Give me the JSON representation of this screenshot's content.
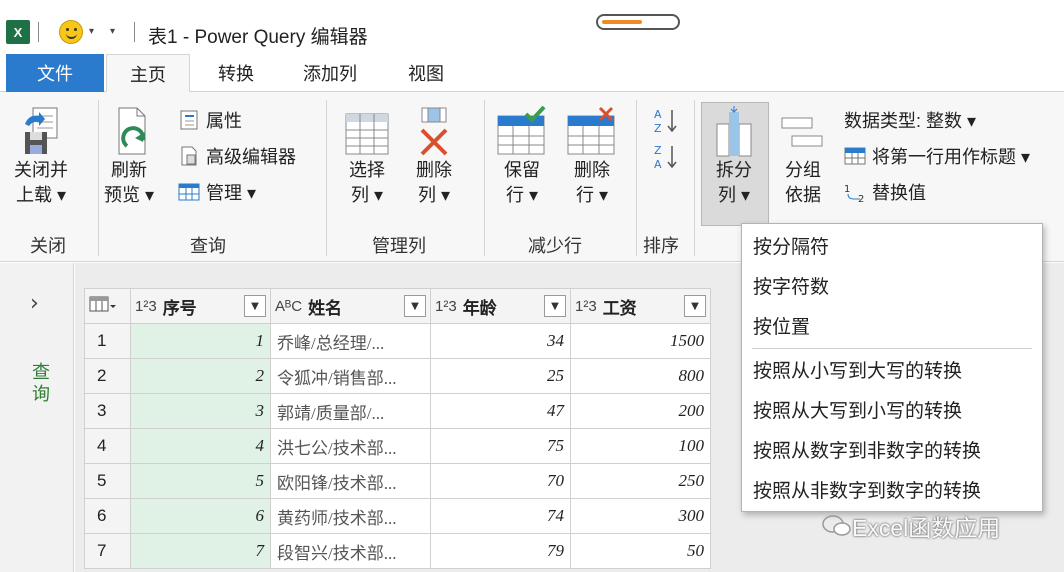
{
  "window": {
    "app_icon": "excel-icon",
    "title": "表1 - Power Query 编辑器",
    "progress_fraction": 0.55
  },
  "tabs": [
    {
      "label": "文件"
    },
    {
      "label": "主页",
      "active": true
    },
    {
      "label": "转换"
    },
    {
      "label": "添加列"
    },
    {
      "label": "视图"
    }
  ],
  "ribbon": {
    "close": {
      "btn_line1": "关闭并",
      "btn_line2": "上载 ▾",
      "group": "关闭"
    },
    "query": {
      "refresh_line1": "刷新",
      "refresh_line2": "预览 ▾",
      "properties": "属性",
      "advanced_editor": "高级编辑器",
      "manage": "管理 ▾",
      "group": "查询"
    },
    "manage_columns": {
      "choose_line1": "选择",
      "choose_line2": "列 ▾",
      "remove_line1": "删除",
      "remove_line2": "列 ▾",
      "group": "管理列"
    },
    "reduce_rows": {
      "keep_line1": "保留",
      "keep_line2": "行 ▾",
      "remove_line1": "删除",
      "remove_line2": "行 ▾",
      "group": "减少行"
    },
    "sort": {
      "group": "排序"
    },
    "transform": {
      "split_line1": "拆分",
      "split_line2": "列 ▾",
      "group_line1": "分组",
      "group_line2": "依据",
      "data_type": "数据类型: 整数 ▾",
      "first_row_header": "将第一行用作标题 ▾",
      "replace_values": "替换值"
    }
  },
  "query_pane": {
    "label": "查询"
  },
  "table": {
    "columns": [
      {
        "type": "1²3",
        "name": "序号"
      },
      {
        "type": "AᴮC",
        "name": "姓名"
      },
      {
        "type": "1²3",
        "name": "年龄"
      },
      {
        "type": "1²3",
        "name": "工资"
      }
    ],
    "rows": [
      {
        "n": "1",
        "id": "1",
        "name": "乔峰/总经理/...",
        "age": "34",
        "salary": "1500"
      },
      {
        "n": "2",
        "id": "2",
        "name": "令狐冲/销售部...",
        "age": "25",
        "salary": "800"
      },
      {
        "n": "3",
        "id": "3",
        "name": "郭靖/质量部/...",
        "age": "47",
        "salary": "200"
      },
      {
        "n": "4",
        "id": "4",
        "name": "洪七公/技术部...",
        "age": "75",
        "salary": "100"
      },
      {
        "n": "5",
        "id": "5",
        "name": "欧阳锋/技术部...",
        "age": "70",
        "salary": "250"
      },
      {
        "n": "6",
        "id": "6",
        "name": "黄药师/技术部...",
        "age": "74",
        "salary": "300"
      },
      {
        "n": "7",
        "id": "7",
        "name": "段智兴/技术部...",
        "age": "79",
        "salary": "50"
      }
    ]
  },
  "split_menu": {
    "items": [
      "按分隔符",
      "按字符数",
      "按位置",
      "按照从小写到大写的转换",
      "按照从大写到小写的转换",
      "按照从数字到非数字的转换",
      "按照从非数字到数字的转换"
    ]
  },
  "watermark": {
    "text": "Excel函数应用"
  },
  "colors": {
    "file_tab": "#2a7bcd",
    "excel_green": "#1e7145",
    "selected_column": "#e0f2e6",
    "progress": "#f08a24"
  }
}
